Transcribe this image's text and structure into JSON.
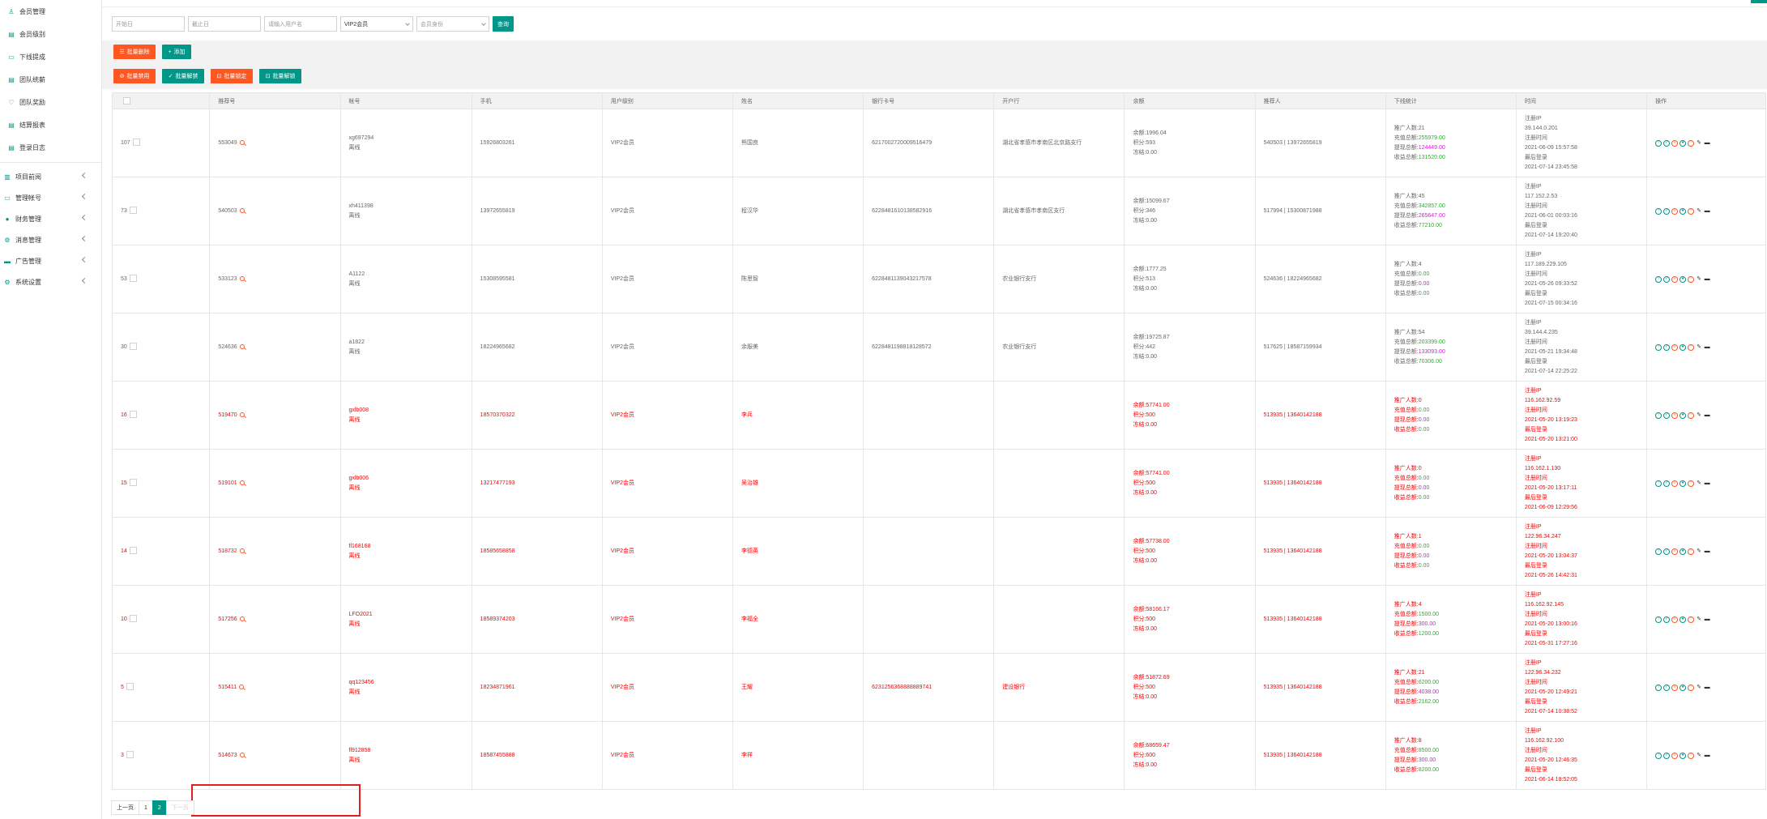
{
  "sidebar": {
    "items": [
      {
        "label": "会员管理",
        "icon": "user-icon"
      },
      {
        "label": "会员级别",
        "icon": "doc-icon"
      },
      {
        "label": "下线提成",
        "icon": "folder-icon"
      },
      {
        "label": "团队统薪",
        "icon": "doc-icon"
      },
      {
        "label": "团队奖励",
        "icon": "heart-icon"
      },
      {
        "label": "结算报表",
        "icon": "doc-icon"
      },
      {
        "label": "登录日志",
        "icon": "doc-icon"
      }
    ],
    "groups": [
      {
        "label": "项目前阅",
        "icon": "book-icon"
      },
      {
        "label": "管理帐号",
        "icon": "folder-icon"
      },
      {
        "label": "财务管理",
        "icon": "circle-icon"
      },
      {
        "label": "消息管理",
        "icon": "gear-icon"
      },
      {
        "label": "广告管理",
        "icon": "card-icon"
      },
      {
        "label": "系统设置",
        "icon": "settings-icon"
      }
    ]
  },
  "search": {
    "start_placeholder": "开始日",
    "end_placeholder": "截止日",
    "user_placeholder": "请输入用户名",
    "level_value": "VIP2会员",
    "status_placeholder": "会员身份",
    "query_label": "查询"
  },
  "toolbar": {
    "batch_delete": "批量删除",
    "add": "添加",
    "batch_disable": "批量禁用",
    "batch_enable": "批量解禁",
    "batch_lock": "批量锁定",
    "batch_unlock": "批量解锁"
  },
  "table": {
    "headers": [
      "",
      "推荐号",
      "帐号",
      "手机",
      "用户级别",
      "姓名",
      "银行卡号",
      "开户行",
      "余额",
      "推荐人",
      "下线统计",
      "时间",
      "操作"
    ],
    "rows": [
      {
        "id": "107",
        "rec": "553049",
        "acct": "xg697294",
        "online": "离线",
        "phone": "15926803261",
        "level": "VIP2会员",
        "name": "熊国良",
        "card": "6217002720009516479",
        "bank": "湖北省孝感市孝南区北京路支行",
        "bal": "余额:1996.04",
        "pts": "积分:593",
        "frz": "冻结:0.00",
        "referrer": "540503 | 13972655819",
        "s1": "推广人数:21",
        "s2l": "充值总额:",
        "s2v": "255979.00",
        "s3l": "提现总额:",
        "s3v": "124449.00",
        "s4l": "收益总额:",
        "s4v": "131520.00",
        "t1": "注册IP",
        "t2": "39.144.0.201",
        "t3": "注册时间",
        "t4": "2021-06-09 15:57:58",
        "t5": "最后登录",
        "t6": "2021-07-14 23:45:58",
        "red": false
      },
      {
        "id": "73",
        "rec": "540503",
        "acct": "xh411398",
        "online": "离线",
        "phone": "13972655819",
        "level": "VIP2会员",
        "name": "程汉华",
        "card": "6228481610138582916",
        "bank": "湖北省孝感市孝南区支行",
        "bal": "余额:15099.67",
        "pts": "积分:346",
        "frz": "冻结:0.00",
        "referrer": "517994 | 15300871988",
        "s1": "推广人数:45",
        "s2l": "充值总额:",
        "s2v": "342857.00",
        "s3l": "提现总额:",
        "s3v": "265647.00",
        "s4l": "收益总额:",
        "s4v": "77210.00",
        "t1": "注册IP",
        "t2": "117.152.2.53",
        "t3": "注册时间",
        "t4": "2021-06-01 00:03:16",
        "t5": "最后登录",
        "t6": "2021-07-14 19:20:40",
        "red": false
      },
      {
        "id": "53",
        "rec": "533123",
        "acct": "A1122",
        "online": "离线",
        "phone": "15308595581",
        "level": "VIP2会员",
        "name": "陈思智",
        "card": "6228481139043217578",
        "bank": "农业银行支行",
        "bal": "余额:1777.25",
        "pts": "积分:513",
        "frz": "冻结:0.00",
        "referrer": "524636 | 18224965682",
        "s1": "推广人数:4",
        "s2l": "充值总额:",
        "s2v": "0.00",
        "s3l": "提现总额:",
        "s3v": "0.00",
        "s4l": "收益总额:",
        "s4v": "0.00",
        "t1": "注册IP",
        "t2": "117.189.229.105",
        "t3": "注册时间",
        "t4": "2021-05-26 09:33:52",
        "t5": "最后登录",
        "t6": "2021-07-15 00:34:16",
        "red": false
      },
      {
        "id": "30",
        "rec": "524636",
        "acct": "a1822",
        "online": "离线",
        "phone": "18224965682",
        "level": "VIP2会员",
        "name": "余服美",
        "card": "6228481198818128572",
        "bank": "农业银行支行",
        "bal": "余额:19725.87",
        "pts": "积分:442",
        "frz": "冻结:0.00",
        "referrer": "517625 | 18587159934",
        "s1": "推广人数:54",
        "s2l": "充值总额:",
        "s2v": "203399.00",
        "s3l": "提现总额:",
        "s3v": "133093.00",
        "s4l": "收益总额:",
        "s4v": "70306.00",
        "t1": "注册IP",
        "t2": "39.144.4.235",
        "t3": "注册时间",
        "t4": "2021-05-21 19:34:48",
        "t5": "最后登录",
        "t6": "2021-07-14 22:25:22",
        "red": false
      },
      {
        "id": "16",
        "rec": "519470",
        "acct": "gxlb008",
        "online": "离线",
        "phone": "18570370322",
        "level": "VIP2会员",
        "name": "李兵",
        "card": "",
        "bank": "",
        "bal": "余额:57741.00",
        "pts": "积分:500",
        "frz": "冻结:0.00",
        "referrer": "513935 | 13640142188",
        "s1": "推广人数:0",
        "s2l": "充值总额:",
        "s2v": "0.00",
        "s3l": "提现总额:",
        "s3v": "0.00",
        "s4l": "收益总额:",
        "s4v": "0.00",
        "t1": "注册IP",
        "t2": "116.162.92.59",
        "t3": "注册时间",
        "t4": "2021-05-20 13:19:23",
        "t5": "最后登录",
        "t6": "2021-05-20 13:21:00",
        "red": true
      },
      {
        "id": "15",
        "rec": "519101",
        "acct": "gxlb006",
        "online": "离线",
        "phone": "13217477193",
        "level": "VIP2会员",
        "name": "吴治雄",
        "card": "",
        "bank": "",
        "bal": "余额:57741.00",
        "pts": "积分:500",
        "frz": "冻结:0.00",
        "referrer": "513935 | 13640142188",
        "s1": "推广人数:0",
        "s2l": "充值总额:",
        "s2v": "0.00",
        "s3l": "提现总额:",
        "s3v": "0.00",
        "s4l": "收益总额:",
        "s4v": "0.00",
        "t1": "注册IP",
        "t2": "116.162.1.130",
        "t3": "注册时间",
        "t4": "2021-05-20 13:17:11",
        "t5": "最后登录",
        "t6": "2021-06-09 12:29:56",
        "red": true
      },
      {
        "id": "14",
        "rec": "518732",
        "acct": "fl168168",
        "online": "离线",
        "phone": "18585658858",
        "level": "VIP2会员",
        "name": "李德英",
        "card": "",
        "bank": "",
        "bal": "余额:57738.00",
        "pts": "积分:500",
        "frz": "冻结:0.00",
        "referrer": "513935 | 13640142188",
        "s1": "推广人数:1",
        "s2l": "充值总额:",
        "s2v": "0.00",
        "s3l": "提现总额:",
        "s3v": "0.00",
        "s4l": "收益总额:",
        "s4v": "0.00",
        "t1": "注册IP",
        "t2": "122.96.34.247",
        "t3": "注册时间",
        "t4": "2021-05-20 13:04:37",
        "t5": "最后登录",
        "t6": "2021-05-26 14:42:31",
        "red": true
      },
      {
        "id": "10",
        "rec": "517256",
        "acct": "LFO2021",
        "online": "离线",
        "phone": "18589374203",
        "level": "VIP2会员",
        "name": "李福全",
        "card": "",
        "bank": "",
        "bal": "余额:58166.17",
        "pts": "积分:500",
        "frz": "冻结:0.00",
        "referrer": "513935 | 13640142188",
        "s1": "推广人数:4",
        "s2l": "充值总额:",
        "s2v": "1500.00",
        "s3l": "提现总额:",
        "s3v": "300.00",
        "s4l": "收益总额:",
        "s4v": "1200.00",
        "t1": "注册IP",
        "t2": "116.162.92.145",
        "t3": "注册时间",
        "t4": "2021-05-20 13:00:16",
        "t5": "最后登录",
        "t6": "2021-05-31 17:27:16",
        "red": true
      },
      {
        "id": "5",
        "rec": "515411",
        "acct": "qq123456",
        "online": "离线",
        "phone": "18234871961",
        "level": "VIP2会员",
        "name": "王耀",
        "card": "6231256368888889741",
        "bank": "建设银行",
        "bal": "余额:51872.69",
        "pts": "积分:500",
        "frz": "冻结:0.00",
        "referrer": "513935 | 13640142188",
        "s1": "推广人数:21",
        "s2l": "充值总额:",
        "s2v": "6200.00",
        "s3l": "提现总额:",
        "s3v": "4038.00",
        "s4l": "收益总额:",
        "s4v": "2162.00",
        "t1": "注册IP",
        "t2": "122.96.34.232",
        "t3": "注册时间",
        "t4": "2021-05-20 12:49:21",
        "t5": "最后登录",
        "t6": "2021-07-14 10:38:52",
        "red": true
      },
      {
        "id": "3",
        "rec": "514673",
        "acct": "fl912858",
        "online": "离线",
        "phone": "18587455888",
        "level": "VIP2会员",
        "name": "李祥",
        "card": "",
        "bank": "",
        "bal": "余额:68659.47",
        "pts": "积分:600",
        "frz": "冻结:0.00",
        "referrer": "513935 | 13640142188",
        "s1": "推广人数:8",
        "s2l": "充值总额:",
        "s2v": "8500.00",
        "s3l": "提现总额:",
        "s3v": "300.00",
        "s4l": "收益总额:",
        "s4v": "8200.00",
        "t1": "注册IP",
        "t2": "116.162.92.100",
        "t3": "注册时间",
        "t4": "2021-05-20 12:46:35",
        "t5": "最后登录",
        "t6": "2021-06-14 18:52:05",
        "red": true
      }
    ]
  },
  "ops_icons": [
    "up-arrow-icon",
    "check-icon",
    "search-icon",
    "lock-icon",
    "info-icon",
    "edit-icon",
    "delete-icon"
  ],
  "pager": {
    "prev": "上一页",
    "p1": "1",
    "p2": "2",
    "next": "下一页"
  },
  "colors": {
    "accent": "#009688",
    "warn": "#ff5722",
    "green": "#00cc00",
    "magenta": "#ff00ff",
    "red": "#ff0000"
  }
}
